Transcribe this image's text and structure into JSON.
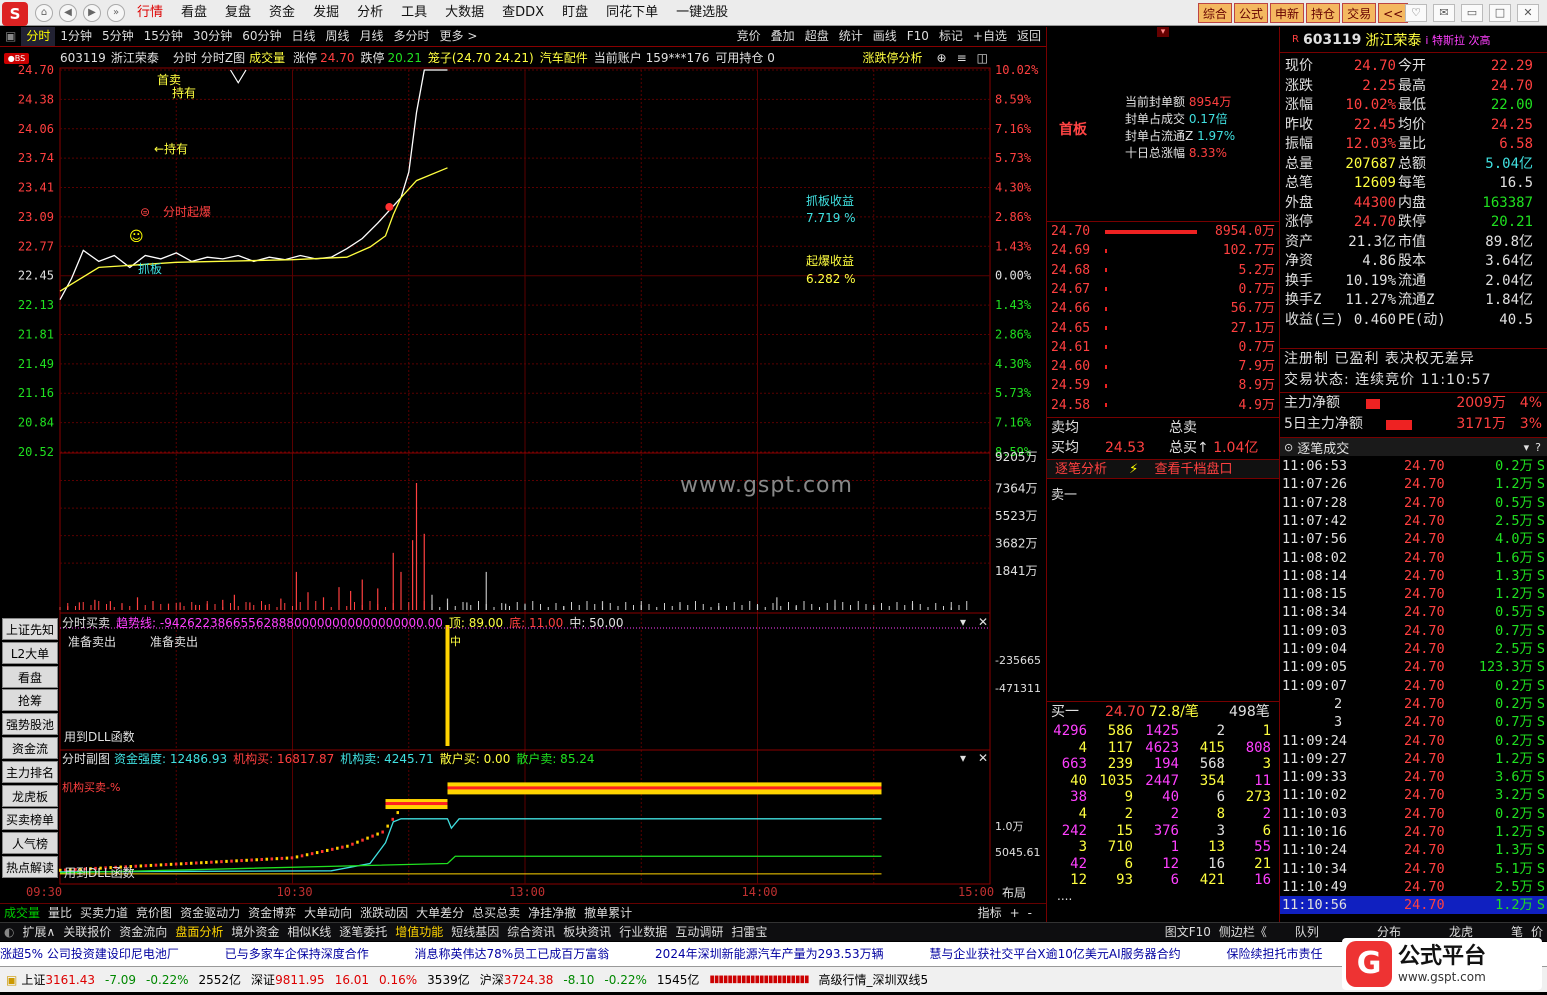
{
  "menu": {
    "items": [
      "行情",
      "看盘",
      "复盘",
      "资金",
      "发掘",
      "分析",
      "工具",
      "大数据",
      "查DDX",
      "盯盘",
      "同花下单",
      "一键选股"
    ],
    "right_tabs": [
      "综合",
      "公式",
      "申新",
      "持仓",
      "交易",
      "<<"
    ],
    "logo": "S"
  },
  "timeframes": [
    "分时",
    "1分钟",
    "5分钟",
    "15分钟",
    "30分钟",
    "60分钟",
    "日线",
    "周线",
    "月线",
    "多分时",
    "更多 >"
  ],
  "toolbar_right": [
    "竞价",
    "叠加",
    "超盘",
    "统计",
    "画线",
    "F10",
    "标记",
    "+自选",
    "返回"
  ],
  "info": {
    "code": "603119",
    "name": "浙江荣泰",
    "mode": "分时",
    "chart2": "分时Z图",
    "vol_label": "成交量",
    "limit_up_label": "涨停",
    "limit_up": "24.70",
    "limit_down_label": "跌停",
    "limit_down": "20.21",
    "range": "笼子(24.70 24.21)",
    "sector": "汽车配件",
    "account": "当前账户 159***176",
    "available": "可用持仓 0",
    "analysis": "涨跌停分析"
  },
  "y_prices": [
    "24.70",
    "24.38",
    "24.06",
    "23.74",
    "23.41",
    "23.09",
    "22.77",
    "22.45",
    "22.13",
    "21.81",
    "21.49",
    "21.16",
    "20.84",
    "20.52"
  ],
  "y_pcts": [
    "10.02%",
    "8.59%",
    "7.16%",
    "5.73%",
    "4.30%",
    "2.86%",
    "1.43%",
    "0.00%",
    "1.43%",
    "2.86%",
    "4.30%",
    "5.73%",
    "7.16%",
    "8.59%"
  ],
  "vol_ticks": [
    "9205万",
    "7364万",
    "5523万",
    "3682万",
    "1841万"
  ],
  "annotations": {
    "a1": "首卖",
    "a2": "持有",
    "a3": "←持有",
    "a4": "分时起爆",
    "a5": "抓板",
    "a6": "抓板收益",
    "a7": "7.719   %",
    "a8": "起爆收益",
    "a9": "6.282   %"
  },
  "sub1": {
    "title": "分时买卖",
    "trend": "趋势线: -9426223866556288800000000000000000.00",
    "top": "顶: 89.00",
    "bottom": "底: 11.00",
    "mid": "中: 50.00",
    "prep1": "准备卖出",
    "prep2": "准备卖出",
    "dll": "用到DLL函数",
    "ticks": [
      "-235665",
      "-471311"
    ],
    "mark": "中"
  },
  "sub2": {
    "title": "分时副图",
    "strength": "资金强度: 12486.93",
    "inst_buy": "机构买: 16817.87",
    "inst_sell": "机构卖: 4245.71",
    "retail_buy": "散户买: 0.00",
    "retail_sell": "散户卖: 85.24",
    "inst_pct": "机构买卖-%",
    "dll": "用到DLL函数",
    "ticks": [
      "1.0万",
      "5045.61"
    ]
  },
  "x_times": [
    "09:30",
    "10:30",
    "13:00",
    "14:00",
    "15:00"
  ],
  "layout_btn": "布局",
  "left_buttons": [
    "上证先知",
    "L2大单",
    "看盘",
    "抢筹",
    "强势股池",
    "资金流",
    "主力排名",
    "龙虎板",
    "买卖榜单",
    "人气榜",
    "热点解读"
  ],
  "bottom_tabs": [
    "成交量",
    "量比",
    "买卖力道",
    "竞价图",
    "资金驱动力",
    "资金博弈",
    "大单动向",
    "涨跌动因",
    "大单差分",
    "总买总卖",
    "净挂净撤",
    "撤单累计"
  ],
  "bottom_right": [
    "指标",
    "+",
    "-"
  ],
  "bottom2": [
    "扩展∧",
    "关联报价",
    "资金流向",
    "盘面分析",
    "境外资金",
    "相似K线",
    "逐笔委托",
    "增值功能",
    "短线基因",
    "综合资讯",
    "板块资讯",
    "行业数据",
    "互动调研",
    "扫雷宝",
    "图文F10",
    "侧边栏《"
  ],
  "bottom2_right": [
    "队列",
    "分布",
    "龙虎",
    "笔",
    "价"
  ],
  "news": [
    "涨超5% 公司投资建设印尼电池厂",
    "已与多家车企保持深度合作",
    "消息称英伟达78%员工已成百万富翁",
    "2024年深圳新能源汽车产量为293.53万辆",
    "慧与企业获社交平台X逾10亿美元AI服务器合约",
    "保险续担托市责任"
  ],
  "status": {
    "sh_label": "上证",
    "sh": "3161.43",
    "sh_ch": "-7.09",
    "sh_pct": "-0.22%",
    "sh_amt": "2552亿",
    "sz_label": "深证",
    "sz": "9811.95",
    "sz_ch": "16.01",
    "sz_pct": "0.16%",
    "sz_amt": "3539亿",
    "hs_label": "沪深",
    "hs": "3724.38",
    "hs_ch": "-8.10",
    "hs_pct": "-0.22%",
    "hs_amt": "1545亿",
    "feed": "高级行情_深圳双线5"
  },
  "mid": {
    "tag": "首板",
    "seal_amt_label": "当前封单额",
    "seal_amt": "8954万",
    "seal_ratio_label": "封单占成交",
    "seal_ratio": "0.17倍",
    "seal_float_label": "封单占流通Z",
    "seal_float": "1.97%",
    "ten_day_label": "十日总涨幅",
    "ten_day": "8.33%",
    "bids": [
      {
        "p": "24.70",
        "v": "8954.0万",
        "w": 92
      },
      {
        "p": "24.69",
        "v": "102.7万",
        "w": 2
      },
      {
        "p": "24.68",
        "v": "5.2万",
        "w": 2
      },
      {
        "p": "24.67",
        "v": "0.7万",
        "w": 2
      },
      {
        "p": "24.66",
        "v": "56.7万",
        "w": 2
      },
      {
        "p": "24.65",
        "v": "27.1万",
        "w": 2
      },
      {
        "p": "24.61",
        "v": "0.7万",
        "w": 2
      },
      {
        "p": "24.60",
        "v": "7.9万",
        "w": 2
      },
      {
        "p": "24.59",
        "v": "8.9万",
        "w": 2
      },
      {
        "p": "24.58",
        "v": "4.9万",
        "w": 2
      }
    ],
    "sell_avg": "卖均",
    "sell_total": "总卖",
    "buy_avg": "买均",
    "buy_avg_val": "24.53",
    "buy_total": "总买↑",
    "buy_total_val": "1.04亿",
    "link1": "逐笔分析",
    "link2": "查看千档盘口",
    "sell1": "卖一",
    "buy1": "买一",
    "buy1_price": "24.70",
    "buy1_amt": "72.8/笔",
    "buy1_count": "498笔",
    "queue": [
      [
        "4296",
        "586",
        "1425",
        "2",
        "1"
      ],
      [
        "4",
        "117",
        "4623",
        "415",
        "808"
      ],
      [
        "663",
        "239",
        "194",
        "568",
        "3"
      ],
      [
        "40",
        "1035",
        "2447",
        "354",
        "11"
      ],
      [
        "38",
        "9",
        "40",
        "6",
        "273"
      ],
      [
        "4",
        "2",
        "2",
        "8",
        "2"
      ],
      [
        "242",
        "15",
        "376",
        "3",
        "6"
      ],
      [
        "3",
        "710",
        "1",
        "13",
        "55"
      ],
      [
        "42",
        "6",
        "12",
        "16",
        "21"
      ],
      [
        "12",
        "93",
        "6",
        "421",
        "16"
      ]
    ],
    "more": "...."
  },
  "quote": {
    "code": "603119",
    "name": "浙江荣泰",
    "flag": "R",
    "extra": "i 特斯拉 次高",
    "rows": [
      [
        "现价",
        "24.70",
        "今开",
        "22.29"
      ],
      [
        "涨跌",
        "2.25",
        "最高",
        "24.70"
      ],
      [
        "涨幅",
        "10.02%",
        "最低",
        "22.00"
      ],
      [
        "昨收",
        "22.45",
        "均价",
        "24.25"
      ],
      [
        "振幅",
        "12.03%",
        "量比",
        "6.58"
      ],
      [
        "总量",
        "207687",
        "总额",
        "5.04亿"
      ],
      [
        "总笔",
        "12609",
        "每笔",
        "16.5"
      ],
      [
        "外盘",
        "44300",
        "内盘",
        "163387"
      ],
      [
        "涨停",
        "24.70",
        "跌停",
        "20.21"
      ],
      [
        "资产",
        "21.3亿",
        "市值",
        "89.8亿"
      ],
      [
        "净资",
        "4.86",
        "股本",
        "3.64亿"
      ],
      [
        "换手",
        "10.19%",
        "流通",
        "2.04亿"
      ],
      [
        "换手Z",
        "11.27%",
        "流通Z",
        "1.84亿"
      ],
      [
        "收益(三)",
        "0.460",
        "PE(动)",
        "40.5"
      ]
    ],
    "reg": "注册制 已盈利 表决权无差异",
    "trade_state": "交易状态: 连续竞价 11:10:57",
    "main_net_label": "主力净额",
    "main_net": "2009万",
    "main_net_pct": "4%",
    "main5_label": "5日主力净额",
    "main5": "3171万",
    "main5_pct": "3%",
    "ticker_title": "逐笔成交"
  },
  "trades": [
    [
      "11:06:53",
      "24.70",
      "0.2万",
      "S"
    ],
    [
      "11:07:26",
      "24.70",
      "1.2万",
      "S"
    ],
    [
      "11:07:28",
      "24.70",
      "0.5万",
      "S"
    ],
    [
      "11:07:42",
      "24.70",
      "2.5万",
      "S"
    ],
    [
      "11:07:56",
      "24.70",
      "4.0万",
      "S"
    ],
    [
      "11:08:02",
      "24.70",
      "1.6万",
      "S"
    ],
    [
      "11:08:14",
      "24.70",
      "1.3万",
      "S"
    ],
    [
      "11:08:15",
      "24.70",
      "1.2万",
      "S"
    ],
    [
      "11:08:34",
      "24.70",
      "0.5万",
      "S"
    ],
    [
      "11:09:03",
      "24.70",
      "0.7万",
      "S"
    ],
    [
      "11:09:04",
      "24.70",
      "2.5万",
      "S"
    ],
    [
      "11:09:05",
      "24.70",
      "123.3万",
      "S"
    ],
    [
      "11:09:07",
      "24.70",
      "0.2万",
      "S"
    ],
    [
      "2",
      "24.70",
      "0.2万",
      "S"
    ],
    [
      "3",
      "24.70",
      "0.7万",
      "S"
    ],
    [
      "11:09:24",
      "24.70",
      "0.2万",
      "S"
    ],
    [
      "11:09:27",
      "24.70",
      "1.2万",
      "S"
    ],
    [
      "11:09:33",
      "24.70",
      "3.6万",
      "S"
    ],
    [
      "11:10:02",
      "24.70",
      "3.2万",
      "S"
    ],
    [
      "11:10:03",
      "24.70",
      "0.2万",
      "S"
    ],
    [
      "11:10:16",
      "24.70",
      "1.2万",
      "S"
    ],
    [
      "11:10:24",
      "24.70",
      "1.3万",
      "S"
    ],
    [
      "11:10:34",
      "24.70",
      "5.1万",
      "S"
    ],
    [
      "11:10:49",
      "24.70",
      "2.5万",
      "S"
    ],
    [
      "11:10:56",
      "24.70",
      "1.2万",
      "S"
    ]
  ],
  "watermark": "www.gspt.com",
  "brand": {
    "name": "公式平台",
    "url": "www.gspt.com"
  },
  "chart_data": {
    "type": "line",
    "ylim": [
      20.21,
      24.7
    ],
    "prev_close": 22.45,
    "price_series": [
      [
        0,
        22.0
      ],
      [
        3,
        22.25
      ],
      [
        6,
        22.58
      ],
      [
        10,
        22.45
      ],
      [
        14,
        22.52
      ],
      [
        18,
        22.38
      ],
      [
        22,
        22.52
      ],
      [
        26,
        22.48
      ],
      [
        30,
        22.55
      ],
      [
        34,
        22.45
      ],
      [
        38,
        22.5
      ],
      [
        42,
        22.48
      ],
      [
        46,
        22.52
      ],
      [
        50,
        22.45
      ],
      [
        54,
        22.5
      ],
      [
        58,
        22.47
      ],
      [
        62,
        22.52
      ],
      [
        66,
        22.48
      ],
      [
        70,
        22.5
      ],
      [
        74,
        22.6
      ],
      [
        78,
        22.72
      ],
      [
        82,
        22.9
      ],
      [
        86,
        23.1
      ],
      [
        88,
        23.2
      ],
      [
        90,
        23.5
      ],
      [
        92,
        24.2
      ],
      [
        94,
        24.7
      ],
      [
        100,
        24.7
      ],
      [
        240,
        24.7
      ]
    ],
    "avg_series": [
      [
        0,
        22.1
      ],
      [
        10,
        22.38
      ],
      [
        30,
        22.44
      ],
      [
        60,
        22.47
      ],
      [
        74,
        22.5
      ],
      [
        80,
        22.62
      ],
      [
        84,
        22.75
      ],
      [
        86,
        23.0
      ],
      [
        88,
        23.2
      ],
      [
        90,
        23.3
      ],
      [
        92,
        23.4
      ],
      [
        100,
        23.55
      ],
      [
        110,
        23.6
      ],
      [
        116,
        23.62
      ],
      [
        120,
        23.7
      ],
      [
        124,
        23.95
      ],
      [
        130,
        24.06
      ],
      [
        150,
        24.12
      ],
      [
        180,
        24.17
      ],
      [
        240,
        24.18
      ]
    ],
    "volume": [
      [
        2,
        3
      ],
      [
        5,
        6
      ],
      [
        9,
        8
      ],
      [
        13,
        7
      ],
      [
        16,
        5
      ],
      [
        20,
        10
      ],
      [
        24,
        7
      ],
      [
        28,
        5
      ],
      [
        31,
        6
      ],
      [
        35,
        4
      ],
      [
        38,
        5
      ],
      [
        42,
        8
      ],
      [
        45,
        12
      ],
      [
        49,
        6
      ],
      [
        53,
        4
      ],
      [
        57,
        9
      ],
      [
        61,
        30
      ],
      [
        64,
        14
      ],
      [
        68,
        10
      ],
      [
        72,
        18
      ],
      [
        75,
        15
      ],
      [
        78,
        24
      ],
      [
        82,
        17
      ],
      [
        86,
        45
      ],
      [
        88,
        30
      ],
      [
        91,
        55
      ],
      [
        92,
        100
      ],
      [
        94,
        60
      ],
      [
        96,
        12
      ],
      [
        100,
        9
      ],
      [
        105,
        6
      ],
      [
        110,
        30
      ],
      [
        115,
        5
      ],
      [
        120,
        5
      ],
      [
        130,
        3
      ],
      [
        140,
        7
      ],
      [
        150,
        4
      ],
      [
        160,
        5
      ],
      [
        170,
        3
      ],
      [
        180,
        4
      ],
      [
        185,
        10
      ],
      [
        190,
        3
      ],
      [
        200,
        8
      ],
      [
        210,
        4
      ],
      [
        220,
        5
      ],
      [
        230,
        2
      ]
    ]
  }
}
